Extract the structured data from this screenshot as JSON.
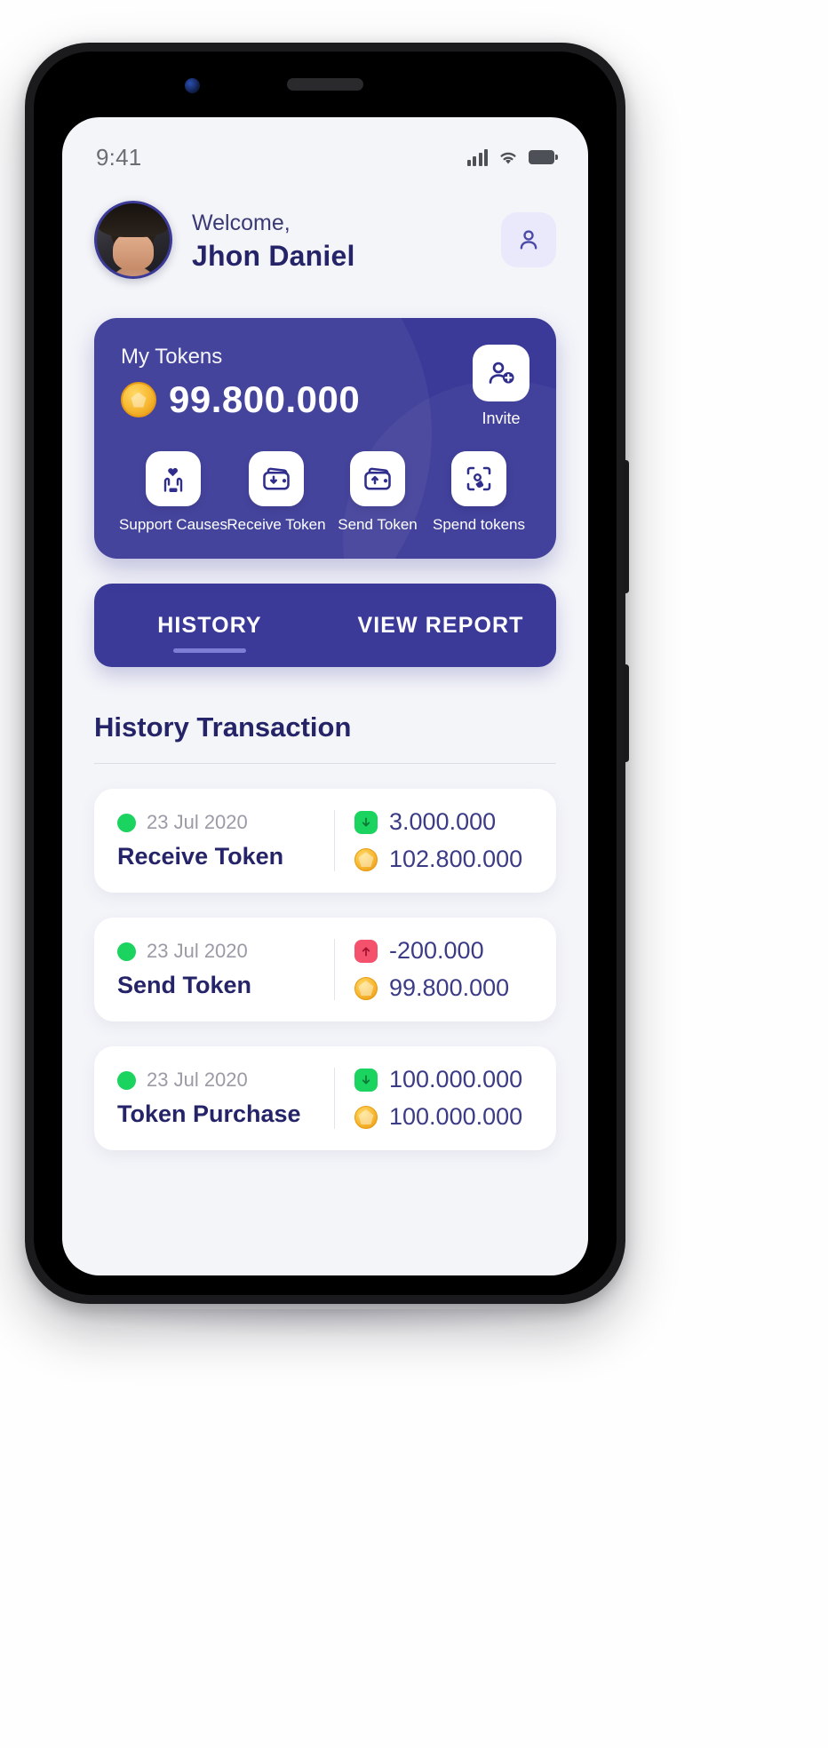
{
  "status_bar": {
    "time": "9:41",
    "signal_icon": "signal-bars-icon",
    "wifi_icon": "wifi-icon",
    "battery_icon": "battery-icon"
  },
  "header": {
    "greeting": "Welcome,",
    "user_name": "Jhon Daniel",
    "avatar_name": "user-avatar",
    "profile_icon": "person-icon"
  },
  "token_card": {
    "label": "My Tokens",
    "balance": "99.800.000",
    "coin_icon": "gold-coin-icon",
    "invite": {
      "label": "Invite",
      "icon": "add-person-icon"
    },
    "actions": [
      {
        "label": "Support Causes",
        "icon": "hands-heart-icon"
      },
      {
        "label": "Receive Token",
        "icon": "wallet-down-arrow-icon"
      },
      {
        "label": "Send Token",
        "icon": "wallet-up-arrow-icon"
      },
      {
        "label": "Spend tokens",
        "icon": "scan-hand-icon"
      }
    ],
    "bg_color": "#3b3a98"
  },
  "tabs": [
    {
      "label": "HISTORY",
      "active": true
    },
    {
      "label": "VIEW REPORT",
      "active": false
    }
  ],
  "history": {
    "title": "History Transaction",
    "transactions": [
      {
        "date": "23 Jul 2020",
        "type": "Receive Token",
        "amount": "3.000.000",
        "balance": "102.800.000",
        "direction": "in",
        "badge_color": "#1bd35f",
        "status_dot_color": "#1bd35f"
      },
      {
        "date": "23 Jul 2020",
        "type": "Send Token",
        "amount": "-200.000",
        "balance": "99.800.000",
        "direction": "out",
        "badge_color": "#f4516c",
        "status_dot_color": "#1bd35f"
      },
      {
        "date": "23 Jul 2020",
        "type": "Token Purchase",
        "amount": "100.000.000",
        "balance": "100.000.000",
        "direction": "in",
        "badge_color": "#1bd35f",
        "status_dot_color": "#1bd35f"
      }
    ]
  },
  "theme": {
    "primary": "#3b3a98",
    "text_dark": "#262468",
    "text_muted": "#9a9ba6",
    "amount_blue": "#3c3b86",
    "green": "#1bd35f",
    "pink": "#f4516c",
    "coin_gold": "#f7b731"
  }
}
